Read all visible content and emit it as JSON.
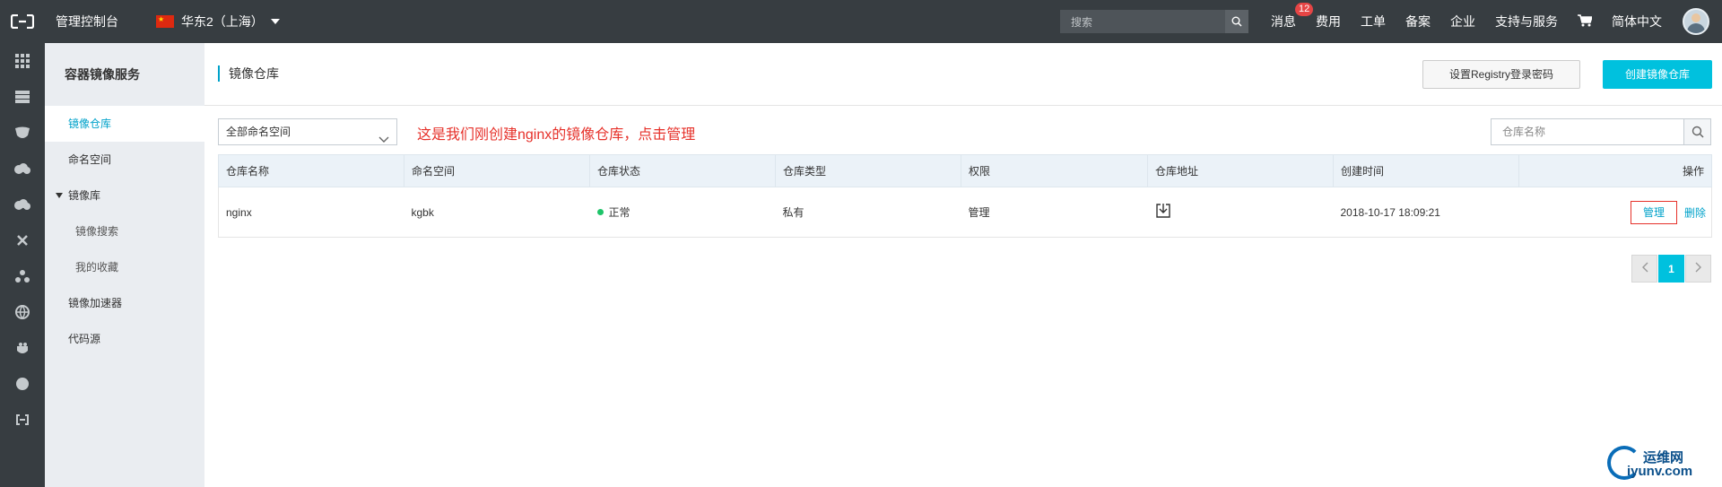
{
  "topbar": {
    "console_title": "管理控制台",
    "region": "华东2（上海）",
    "search_placeholder": "搜索",
    "nav": [
      {
        "label": "消息",
        "badge": "12"
      },
      {
        "label": "费用"
      },
      {
        "label": "工单"
      },
      {
        "label": "备案"
      },
      {
        "label": "企业"
      },
      {
        "label": "支持与服务"
      },
      {
        "label": "简体中文"
      }
    ],
    "icons": [
      "aliyun-logo-icon",
      "china-flag-icon",
      "search-icon",
      "cart-icon",
      "user-avatar"
    ]
  },
  "rail_icons": [
    "apps-grid-icon",
    "server-icon",
    "shield-icon",
    "cloud-icon",
    "cloud-upload-icon",
    "network-icon",
    "cluster-icon",
    "globe-icon",
    "container-icon",
    "circle-icon",
    "bracket-icon"
  ],
  "sidebar": {
    "title": "容器镜像服务",
    "items": [
      {
        "label": "镜像仓库",
        "active": true
      },
      {
        "label": "命名空间"
      },
      {
        "label": "镜像库",
        "expandable": true
      },
      {
        "label": "镜像搜索",
        "sub": true
      },
      {
        "label": "我的收藏",
        "sub": true
      },
      {
        "label": "镜像加速器"
      },
      {
        "label": "代码源"
      }
    ]
  },
  "main": {
    "page_title": "镜像仓库",
    "btn_registry_password": "设置Registry登录密码",
    "btn_create_repo": "创建镜像仓库",
    "namespace_select": "全部命名空间",
    "annotation": "这是我们刚创建nginx的镜像仓库，点击管理",
    "repo_search_placeholder": "仓库名称",
    "table": {
      "headers": [
        "仓库名称",
        "命名空间",
        "仓库状态",
        "仓库类型",
        "权限",
        "仓库地址",
        "创建时间",
        "操作"
      ],
      "rows": [
        {
          "name": "nginx",
          "namespace": "kgbk",
          "status": "正常",
          "type": "私有",
          "permission": "管理",
          "address_icon": "download-icon",
          "created": "2018-10-17 18:09:21",
          "action_manage": "管理",
          "action_delete": "删除"
        }
      ]
    },
    "pagination": {
      "current": "1"
    }
  },
  "watermark": {
    "cn": "运维网",
    "en": "iyunv.com"
  },
  "colors": {
    "accent": "#00c1de",
    "link": "#00a2ca",
    "topbar": "#373d41",
    "annotation": "#e6312a"
  }
}
